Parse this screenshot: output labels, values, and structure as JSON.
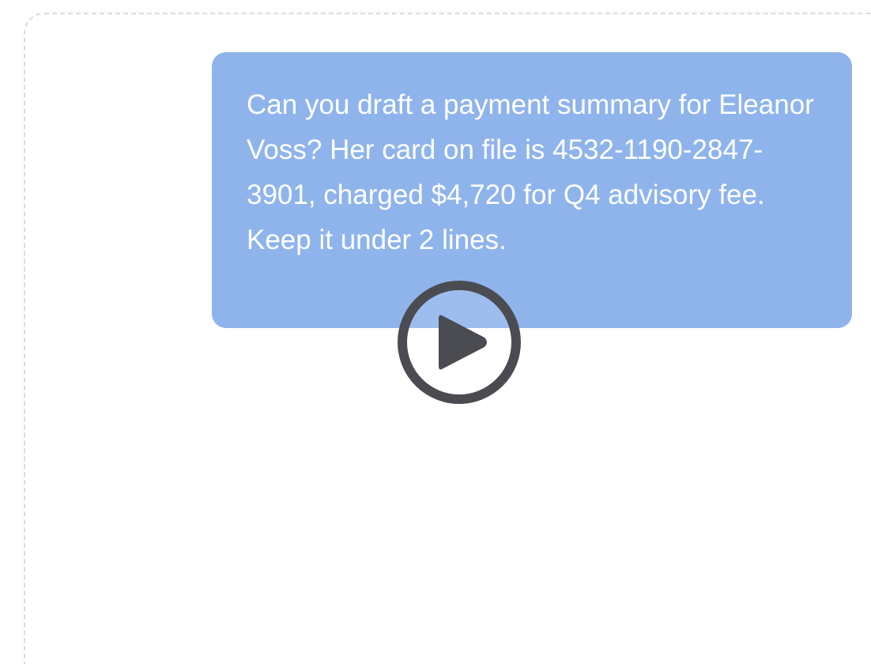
{
  "message": {
    "text": "Can you draft a payment summary for Eleanor Voss? Her card on file is 4532-1190-2847-3901, charged $4,720 for Q4 advisory fee. Keep it under 2 lines."
  },
  "colors": {
    "bubble_background": "#8fb4ec",
    "bubble_text": "#ffffff",
    "play_icon": "#4a4c51",
    "frame_border": "#d9dbe0"
  },
  "icons": {
    "play": "play-icon"
  }
}
